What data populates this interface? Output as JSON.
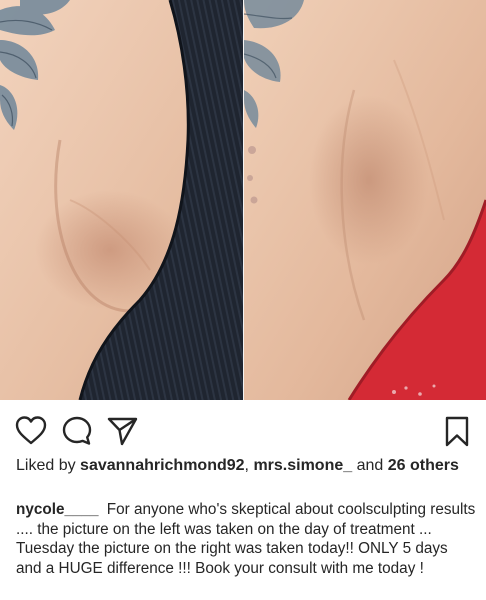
{
  "media": {
    "left_photo_desc": "before",
    "right_photo_desc": "after"
  },
  "actions": {
    "like_icon": "heart-icon",
    "comment_icon": "comment-bubble-icon",
    "share_icon": "paper-plane-icon",
    "save_icon": "bookmark-icon"
  },
  "likes": {
    "prefix": "Liked by ",
    "user1": "savannahrichmond92",
    "sep": ", ",
    "user2": "mrs.simone_",
    "and": " and ",
    "others": "26 others"
  },
  "caption": {
    "username": "nycole____",
    "text": "For anyone who's skeptical about coolsculpting results .... the picture on the left was taken on the day of treatment ... Tuesday the picture on the right was taken today!! ONLY 5 days and a HUGE difference !!! Book your consult with me today !"
  },
  "colors": {
    "text": "#262626",
    "tank_top": "#1f2530",
    "red_top": "#d42a35",
    "skin": "#e9c1a6"
  }
}
